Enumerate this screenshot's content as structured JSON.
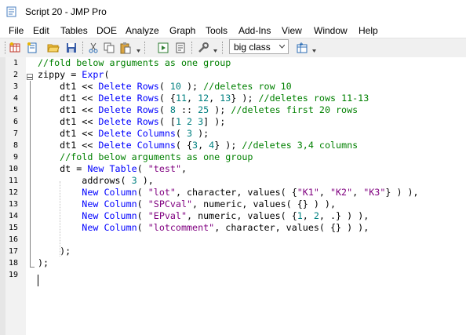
{
  "window": {
    "title": "Script 20 - JMP Pro"
  },
  "menu": [
    "File",
    "Edit",
    "Tables",
    "DOE",
    "Analyze",
    "Graph",
    "Tools",
    "Add-Ins",
    "View",
    "Window",
    "Help"
  ],
  "toolbar": {
    "icons": [
      "new-data-table-icon",
      "new-script-icon",
      "open-folder-icon",
      "save-icon",
      "cut-icon",
      "copy-icon",
      "paste-icon",
      "run-script-icon",
      "script-page-icon",
      "wrench-icon",
      "data-table-icon"
    ],
    "table_select_value": "big class"
  },
  "editor": {
    "line_numbers": [
      "1",
      "2",
      "3",
      "4",
      "5",
      "6",
      "7",
      "8",
      "9",
      "10",
      "11",
      "12",
      "13",
      "14",
      "15",
      "16",
      "17",
      "18",
      "19"
    ]
  },
  "code": [
    [
      {
        "c": "cmt",
        "t": "//fold below arguments as one group"
      }
    ],
    [
      {
        "c": "txt",
        "t": "zippy = "
      },
      {
        "c": "kw",
        "t": "Expr"
      },
      {
        "c": "txt",
        "t": "("
      }
    ],
    [
      {
        "c": "txt",
        "t": "    dt1 << "
      },
      {
        "c": "kw",
        "t": "Delete Rows"
      },
      {
        "c": "txt",
        "t": "( "
      },
      {
        "c": "num",
        "t": "10"
      },
      {
        "c": "txt",
        "t": " ); "
      },
      {
        "c": "cmt",
        "t": "//deletes row 10"
      }
    ],
    [
      {
        "c": "txt",
        "t": "    dt1 << "
      },
      {
        "c": "kw",
        "t": "Delete Rows"
      },
      {
        "c": "txt",
        "t": "( {"
      },
      {
        "c": "num",
        "t": "11"
      },
      {
        "c": "txt",
        "t": ", "
      },
      {
        "c": "num",
        "t": "12"
      },
      {
        "c": "txt",
        "t": ", "
      },
      {
        "c": "num",
        "t": "13"
      },
      {
        "c": "txt",
        "t": "} ); "
      },
      {
        "c": "cmt",
        "t": "//deletes rows 11-13"
      }
    ],
    [
      {
        "c": "txt",
        "t": "    dt1 << "
      },
      {
        "c": "kw",
        "t": "Delete Rows"
      },
      {
        "c": "txt",
        "t": "( "
      },
      {
        "c": "num",
        "t": "8"
      },
      {
        "c": "txt",
        "t": " :: "
      },
      {
        "c": "num",
        "t": "25"
      },
      {
        "c": "txt",
        "t": " ); "
      },
      {
        "c": "cmt",
        "t": "//deletes first 20 rows"
      }
    ],
    [
      {
        "c": "txt",
        "t": "    dt1 << "
      },
      {
        "c": "kw",
        "t": "Delete Rows"
      },
      {
        "c": "txt",
        "t": "( ["
      },
      {
        "c": "num",
        "t": "1 2 3"
      },
      {
        "c": "txt",
        "t": "] );"
      }
    ],
    [
      {
        "c": "txt",
        "t": "    dt1 << "
      },
      {
        "c": "kw",
        "t": "Delete Columns"
      },
      {
        "c": "txt",
        "t": "( "
      },
      {
        "c": "num",
        "t": "3"
      },
      {
        "c": "txt",
        "t": " );"
      }
    ],
    [
      {
        "c": "txt",
        "t": "    dt1 << "
      },
      {
        "c": "kw",
        "t": "Delete Columns"
      },
      {
        "c": "txt",
        "t": "( {"
      },
      {
        "c": "num",
        "t": "3"
      },
      {
        "c": "txt",
        "t": ", "
      },
      {
        "c": "num",
        "t": "4"
      },
      {
        "c": "txt",
        "t": "} ); "
      },
      {
        "c": "cmt",
        "t": "//deletes 3,4 columns"
      }
    ],
    [
      {
        "c": "txt",
        "t": "    "
      },
      {
        "c": "cmt",
        "t": "//fold below arguments as one group"
      }
    ],
    [
      {
        "c": "txt",
        "t": "    dt = "
      },
      {
        "c": "kw",
        "t": "New Table"
      },
      {
        "c": "txt",
        "t": "( "
      },
      {
        "c": "str",
        "t": "\"test\""
      },
      {
        "c": "txt",
        "t": ","
      }
    ],
    [
      {
        "c": "txt",
        "t": "        addrows( "
      },
      {
        "c": "num",
        "t": "3"
      },
      {
        "c": "txt",
        "t": " ),"
      }
    ],
    [
      {
        "c": "txt",
        "t": "        "
      },
      {
        "c": "kw",
        "t": "New Column"
      },
      {
        "c": "txt",
        "t": "( "
      },
      {
        "c": "str",
        "t": "\"lot\""
      },
      {
        "c": "txt",
        "t": ", character, values( {"
      },
      {
        "c": "str",
        "t": "\"K1\""
      },
      {
        "c": "txt",
        "t": ", "
      },
      {
        "c": "str",
        "t": "\"K2\""
      },
      {
        "c": "txt",
        "t": ", "
      },
      {
        "c": "str",
        "t": "\"K3\""
      },
      {
        "c": "txt",
        "t": "} ) ),"
      }
    ],
    [
      {
        "c": "txt",
        "t": "        "
      },
      {
        "c": "kw",
        "t": "New Column"
      },
      {
        "c": "txt",
        "t": "( "
      },
      {
        "c": "str",
        "t": "\"SPCval\""
      },
      {
        "c": "txt",
        "t": ", numeric, values( {} ) ),"
      }
    ],
    [
      {
        "c": "txt",
        "t": "        "
      },
      {
        "c": "kw",
        "t": "New Column"
      },
      {
        "c": "txt",
        "t": "( "
      },
      {
        "c": "str",
        "t": "\"EPval\""
      },
      {
        "c": "txt",
        "t": ", numeric, values( {"
      },
      {
        "c": "num",
        "t": "1"
      },
      {
        "c": "txt",
        "t": ", "
      },
      {
        "c": "num",
        "t": "2"
      },
      {
        "c": "txt",
        "t": ", ."
      },
      {
        "c": "txt",
        "t": "} ) ),"
      }
    ],
    [
      {
        "c": "txt",
        "t": "        "
      },
      {
        "c": "kw",
        "t": "New Column"
      },
      {
        "c": "txt",
        "t": "( "
      },
      {
        "c": "str",
        "t": "\"lotcomment\""
      },
      {
        "c": "txt",
        "t": ", character, values( {} ) ),"
      }
    ],
    [
      {
        "c": "txt",
        "t": ""
      }
    ],
    [
      {
        "c": "txt",
        "t": "    );"
      }
    ],
    [
      {
        "c": "txt",
        "t": ");"
      }
    ],
    [
      {
        "c": "txt",
        "t": ""
      }
    ]
  ]
}
